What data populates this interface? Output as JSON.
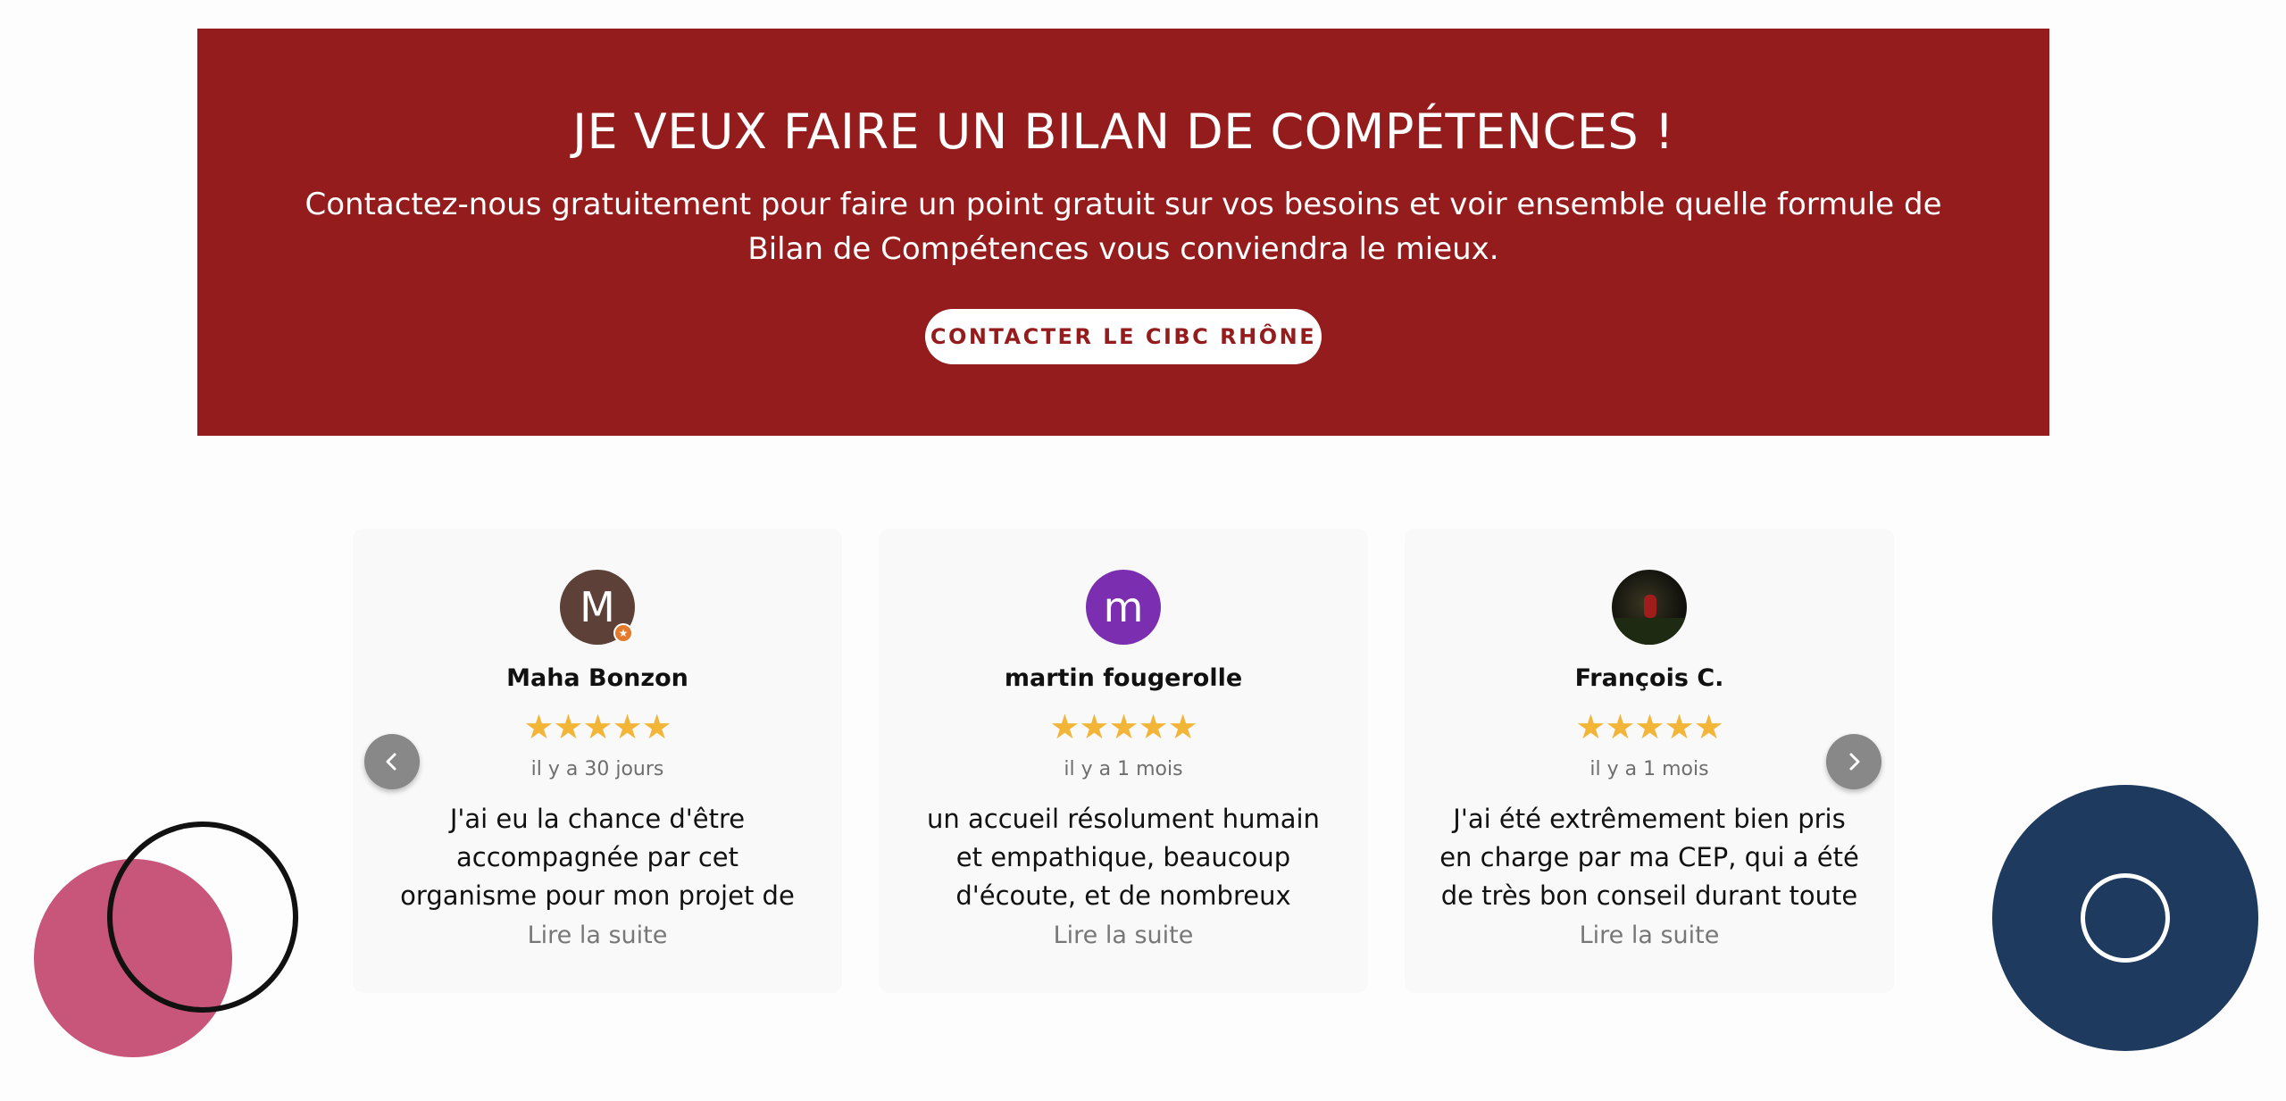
{
  "cta": {
    "title": "JE VEUX FAIRE UN BILAN DE COMPÉTENCES !",
    "text": "Contactez-nous gratuitement pour faire un point gratuit sur vos besoins et voir ensemble quelle formule de Bilan de Compétences vous conviendra le mieux.",
    "button_label": "CONTACTER LE CIBC RHÔNE"
  },
  "reviews": [
    {
      "avatar_initial": "M",
      "avatar_color": "#5d4037",
      "name": "Maha Bonzon",
      "stars": "★★★★★",
      "date": "il y a 30 jours",
      "text": "J'ai eu la chance d'être accompagnée par cet organisme pour mon projet de formation. Je",
      "read_more": "Lire la suite"
    },
    {
      "avatar_initial": "m",
      "avatar_color": "#7b2fb0",
      "name": "martin fougerolle",
      "stars": "★★★★★",
      "date": "il y a 1 mois",
      "text": "un accueil résolument humain et empathique, beaucoup d'écoute, et de nombreux conseils",
      "read_more": "Lire la suite"
    },
    {
      "avatar_initial": "",
      "avatar_color": "#111111",
      "name": "François C.",
      "stars": "★★★★★",
      "date": "il y a 1 mois",
      "text": "J'ai été extrêmement bien pris en charge par ma CEP, qui a été de très bon conseil durant toute",
      "read_more": "Lire la suite"
    }
  ],
  "rating_value": 5,
  "rating_max": 5,
  "icons": {
    "prev": "chevron-left-icon",
    "next": "chevron-right-icon",
    "star": "star-icon"
  },
  "colors": {
    "banner": "#951c1d",
    "star": "#f2b538",
    "deco_pink": "#c8557a",
    "deco_navy": "#1e3a5f"
  }
}
